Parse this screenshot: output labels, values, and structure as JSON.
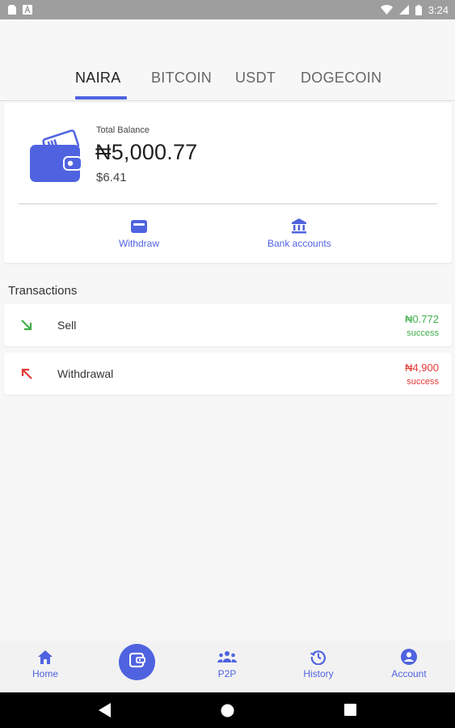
{
  "status_bar": {
    "time": "3:24",
    "icons": [
      "sim-card-icon",
      "a-badge-icon",
      "wifi-icon",
      "signal-icon",
      "battery-icon"
    ]
  },
  "tabs": [
    {
      "label": "NAIRA",
      "active": true
    },
    {
      "label": "BITCOIN",
      "active": false
    },
    {
      "label": "USDT",
      "active": false
    },
    {
      "label": "DOGECOIN",
      "active": false
    }
  ],
  "balance": {
    "label": "Total Balance",
    "amount": "₦5,000.77",
    "usd": "$6.41",
    "icon": "wallet-money-icon"
  },
  "actions": {
    "withdraw": {
      "label": "Withdraw",
      "icon": "wallet-icon"
    },
    "bank_accounts": {
      "label": "Bank accounts",
      "icon": "bank-icon"
    }
  },
  "transactions": {
    "title": "Transactions",
    "items": [
      {
        "type": "Sell",
        "amount": "₦0.772",
        "status": "success",
        "icon": "arrow-down-right-icon",
        "color": "#3fae49"
      },
      {
        "type": "Withdrawal",
        "amount": "₦4,900",
        "status": "success",
        "icon": "arrow-up-left-icon",
        "color": "#e53935"
      }
    ]
  },
  "bottom_nav": {
    "home": {
      "label": "Home",
      "icon": "home-icon"
    },
    "wallet": {
      "icon": "wallet-icon",
      "active": true
    },
    "p2p": {
      "label": "P2P",
      "icon": "people-icon"
    },
    "history": {
      "label": "History",
      "icon": "history-icon"
    },
    "account": {
      "label": "Account",
      "icon": "account-icon"
    }
  },
  "colors": {
    "accent": "#4f63e0",
    "success_green": "#3fae49",
    "debit_red": "#e53935"
  }
}
